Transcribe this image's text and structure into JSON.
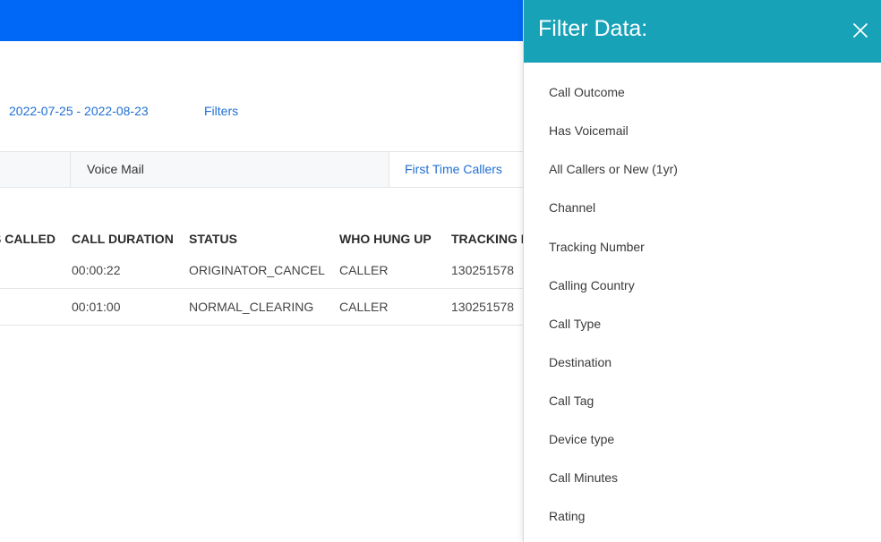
{
  "toolbar": {
    "date_range": "2022-07-25 - 2022-08-23",
    "filters_label": "Filters"
  },
  "tabs": [
    {
      "label": "Voice Mail"
    },
    {
      "label": "First Time Callers"
    }
  ],
  "table": {
    "headers": [
      "S CALLED",
      "CALL DURATION",
      "STATUS",
      "WHO HUNG UP",
      "TRACKING N"
    ],
    "rows": [
      [
        "",
        "00:00:22",
        "ORIGINATOR_CANCEL",
        "CALLER",
        "130251578"
      ],
      [
        "",
        "00:01:00",
        "NORMAL_CLEARING",
        "CALLER",
        "130251578"
      ]
    ]
  },
  "filter_panel": {
    "title": "Filter Data:",
    "close_icon": "close-icon",
    "items": [
      "Call Outcome",
      "Has Voicemail",
      "All Callers or New (1yr)",
      "Channel",
      "Tracking Number",
      "Calling Country",
      "Call Type",
      "Destination",
      "Call Tag",
      "Device type",
      "Call Minutes",
      "Rating"
    ]
  },
  "colors": {
    "topbar": "#0068f7",
    "panel_header": "#17a2b8",
    "link": "#1f6fd1"
  }
}
